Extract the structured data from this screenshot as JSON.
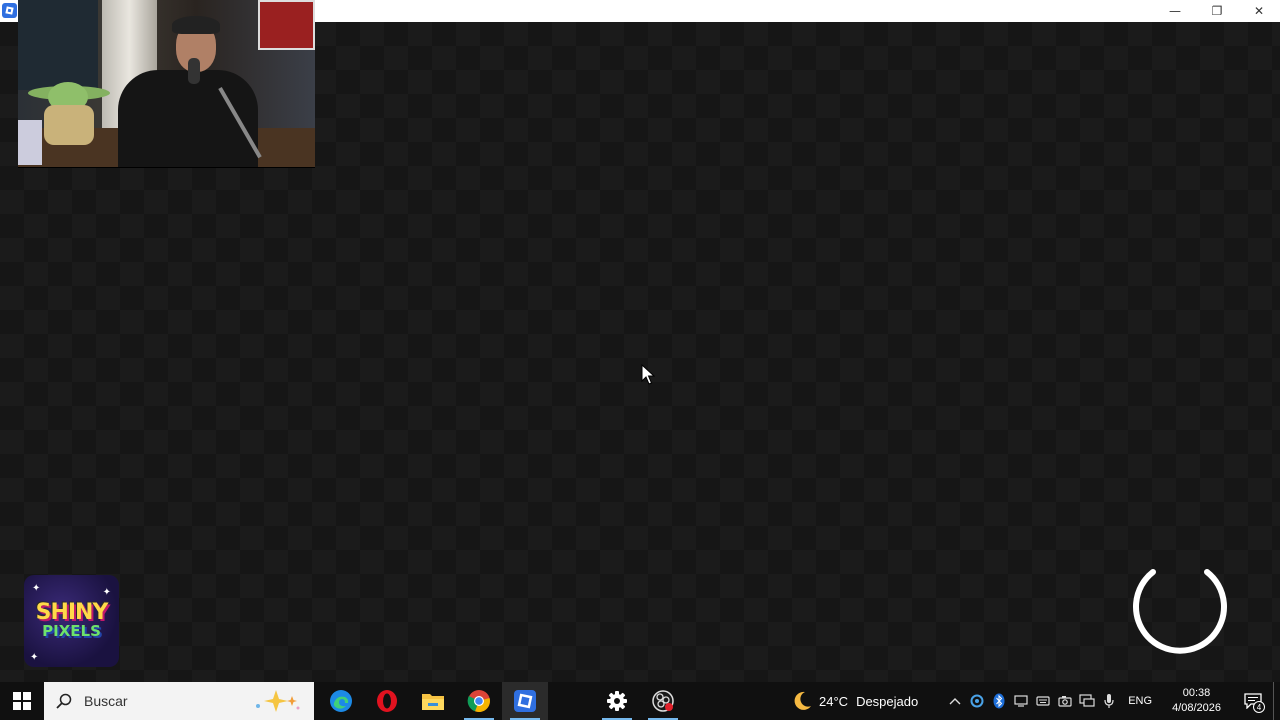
{
  "window": {
    "icon": "roblox-icon",
    "controls": {
      "minimize": "—",
      "restore": "❐",
      "close": "✕"
    }
  },
  "overlay": {
    "webcam": "webcam-feed",
    "logo": {
      "line1": "SHINY",
      "line2": "PIXELS"
    }
  },
  "loading": {
    "indicator": "loading-spinner"
  },
  "taskbar": {
    "search": {
      "placeholder": "Buscar"
    },
    "apps": [
      {
        "name": "edge-icon",
        "state": "pinned"
      },
      {
        "name": "opera-icon",
        "state": "pinned"
      },
      {
        "name": "file-explorer-icon",
        "state": "pinned"
      },
      {
        "name": "chrome-icon",
        "state": "running"
      },
      {
        "name": "roblox-icon",
        "state": "active"
      },
      {
        "name": "settings-icon",
        "state": "running"
      },
      {
        "name": "obs-icon",
        "state": "running"
      }
    ],
    "weather": {
      "temp": "24°C",
      "condition": "Despejado"
    },
    "language": "ENG",
    "clock": {
      "time": "00:38",
      "date": "4/08/2026"
    },
    "notifications": {
      "count": "4"
    }
  },
  "colors": {
    "accent": "#76b9ed",
    "roblox_blue": "#2f6fe0",
    "background": "#161616"
  }
}
